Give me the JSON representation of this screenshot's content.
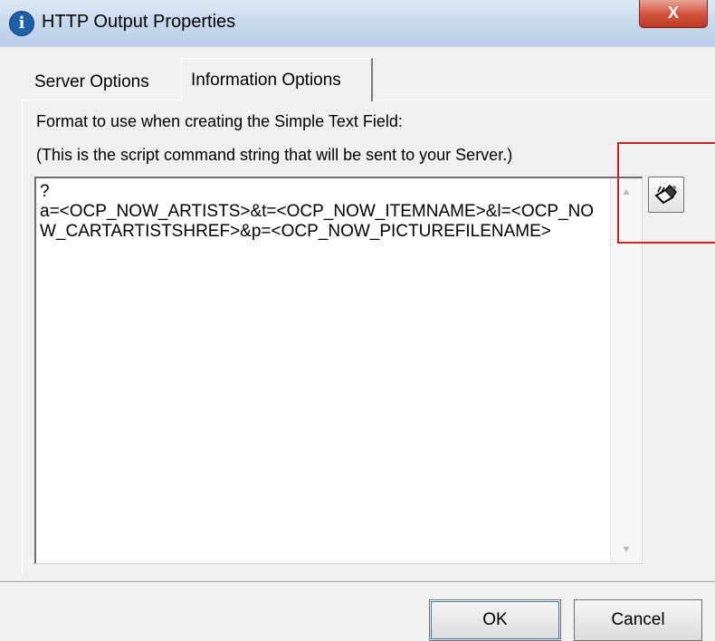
{
  "window": {
    "title": "HTTP Output Properties",
    "close_glyph": "X"
  },
  "tabs": [
    {
      "label": "Server Options",
      "active": false
    },
    {
      "label": "Information Options",
      "active": true
    }
  ],
  "panel": {
    "line1": "Format to use when creating the Simple Text Field:",
    "line2": "(This is the script command string that will be sent to your Server.)",
    "format_value": "?\na=<OCP_NOW_ARTISTS>&t=<OCP_NOW_ITEMNAME>&l=<OCP_NOW_CARTARTISTSHREF>&p=<OCP_NOW_PICTUREFILENAME>"
  },
  "buttons": {
    "ok": "OK",
    "cancel": "Cancel"
  },
  "icons": {
    "title": "info-icon",
    "tag_picker": "eyedropper-icon",
    "scroll_up": "scroll-up-arrow-icon",
    "scroll_down": "scroll-down-arrow-icon"
  },
  "colors": {
    "highlight": "#c6242a",
    "title_icon": "#1f5fa8"
  }
}
